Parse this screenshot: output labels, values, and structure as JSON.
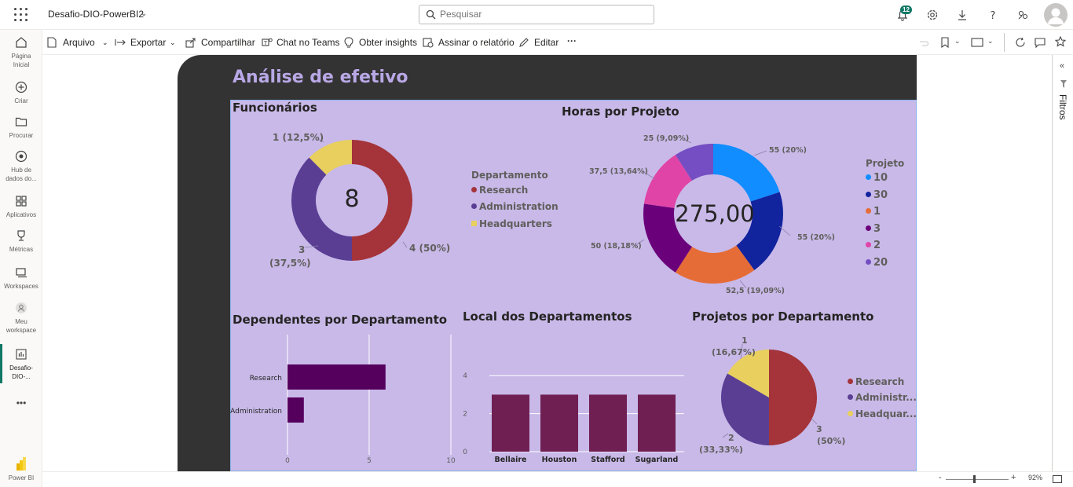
{
  "app": {
    "report_name": "Desafio-DIO-PowerBI2",
    "search_placeholder": "Pesquisar",
    "notifications_count": "12"
  },
  "leftnav": {
    "items": [
      {
        "label1": "Página",
        "label2": "Inicial"
      },
      {
        "label1": "Criar",
        "label2": ""
      },
      {
        "label1": "Procurar",
        "label2": ""
      },
      {
        "label1": "Hub de",
        "label2": "dados do..."
      },
      {
        "label1": "Aplicativos",
        "label2": ""
      },
      {
        "label1": "Métricas",
        "label2": ""
      },
      {
        "label1": "Workspaces",
        "label2": ""
      },
      {
        "label1": "Meu",
        "label2": "workspace"
      },
      {
        "label1": "Desafio-",
        "label2": "DIO-..."
      }
    ],
    "more": "•••",
    "footer": "Power BI"
  },
  "toolbar": {
    "arquivo": "Arquivo",
    "exportar": "Exportar",
    "compartilhar": "Compartilhar",
    "chat_teams": "Chat no Teams",
    "insights": "Obter insights",
    "assinar": "Assinar o relatório",
    "editar": "Editar",
    "more": "···"
  },
  "filters": {
    "label": "Filtros"
  },
  "status": {
    "zoom": "92%"
  },
  "report": {
    "title": "Análise de efetivo",
    "funcionarios": {
      "title": "Funcionários",
      "center": "8",
      "legend_title": "Departamento",
      "labels": [
        "4 (50%)",
        "3",
        "(37,5%)",
        "1 (12,5%)"
      ]
    },
    "horas": {
      "title": "Horas por Projeto",
      "center": "275,00",
      "legend_title": "Projeto",
      "labels": [
        "55 (20%)",
        "55 (20%)",
        "52,5 (19,09%)",
        "50 (18,18%)",
        "37,5 (13,64%)",
        "25 (9,09%)"
      ]
    },
    "dependentes": {
      "title": "Dependentes por Departamento"
    },
    "local": {
      "title": "Local dos Departamentos"
    },
    "projetos": {
      "title": "Projetos por Departamento",
      "labels": [
        "3",
        "(50%)",
        "2",
        "(33,33%)",
        "1",
        "(16,67%)"
      ],
      "legend": [
        "Research",
        "Administr...",
        "Headquar..."
      ]
    }
  },
  "chart_data": [
    {
      "type": "pie",
      "title": "Funcionários",
      "variant": "donut",
      "legend_title": "Departamento",
      "categories": [
        "Research",
        "Administration",
        "Headquarters"
      ],
      "values": [
        4,
        3,
        1
      ],
      "colors": [
        "#a4343a",
        "#5a3e94",
        "#e8cf5e"
      ],
      "total_label": "8"
    },
    {
      "type": "pie",
      "title": "Horas por Projeto",
      "variant": "donut",
      "legend_title": "Projeto",
      "categories": [
        "10",
        "30",
        "1",
        "3",
        "2",
        "20"
      ],
      "values": [
        55,
        55,
        52.5,
        50,
        37.5,
        25
      ],
      "colors": [
        "#118dff",
        "#12239e",
        "#e66c37",
        "#6b007b",
        "#e044a7",
        "#744ec2"
      ],
      "total_label": "275,00"
    },
    {
      "type": "bar",
      "orientation": "horizontal",
      "title": "Dependentes por Departamento",
      "categories": [
        "Research",
        "Administration"
      ],
      "values": [
        6,
        1
      ],
      "xlim": [
        0,
        10
      ],
      "xticks": [
        0,
        5,
        10
      ],
      "color": "#56005e"
    },
    {
      "type": "bar",
      "title": "Local dos Departamentos",
      "categories": [
        "Bellaire",
        "Houston",
        "Stafford",
        "Sugarland"
      ],
      "values": [
        3,
        3,
        3,
        3
      ],
      "ylim": [
        0,
        5
      ],
      "yticks": [
        0,
        2,
        4
      ],
      "color": "#701f53"
    },
    {
      "type": "pie",
      "title": "Projetos por Departamento",
      "categories": [
        "Research",
        "Administration",
        "Headquarters"
      ],
      "values": [
        3,
        2,
        1
      ],
      "colors": [
        "#a4343a",
        "#5a3e94",
        "#e8cf5e"
      ]
    }
  ]
}
